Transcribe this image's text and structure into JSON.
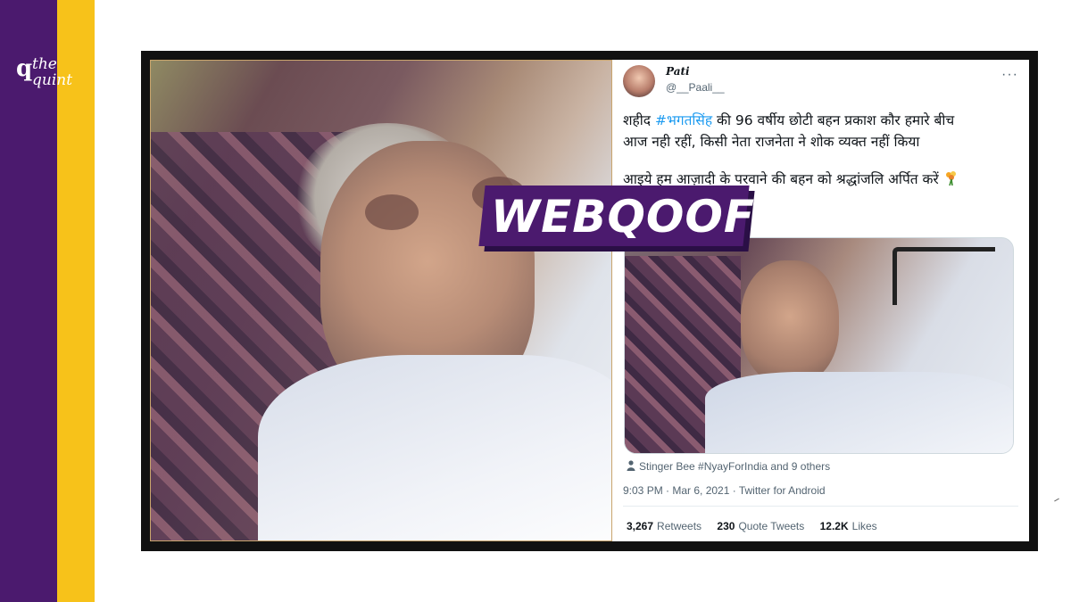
{
  "brand": {
    "logo_mark": "q",
    "logo_line1": "the",
    "logo_line2": "quint",
    "colors": {
      "purple": "#4b1a6e",
      "yellow": "#f7c21a"
    }
  },
  "tweet": {
    "display_name": "Pati",
    "handle": "@__Paali__",
    "more_icon": "···",
    "text_prefix": "शहीद ",
    "hashtag": "#भगतसिंह",
    "text_line1_rest": "  की 96 वर्षीय  छोटी बहन प्रकाश कौर हमारे बीच",
    "text_line2": "आज नही रहीं, किसी नेता राजनेता ने शोक व्यक्त नहीं किया",
    "text_line3": "आइये हम आज़ादी के परवाने की बहन को श्रद्धांजलि अर्पित करें",
    "liked_by": "Stinger Bee #NyayForIndia and 9 others",
    "timestamp": "9:03 PM · Mar 6, 2021 · Twitter for Android",
    "stats": {
      "retweets_count": "3,267",
      "retweets_label": "Retweets",
      "quotes_count": "230",
      "quotes_label": "Quote Tweets",
      "likes_count": "12.2K",
      "likes_label": "Likes"
    },
    "link_color": "#1d9bf0"
  },
  "overlay": {
    "label": "WEBQOOF"
  }
}
